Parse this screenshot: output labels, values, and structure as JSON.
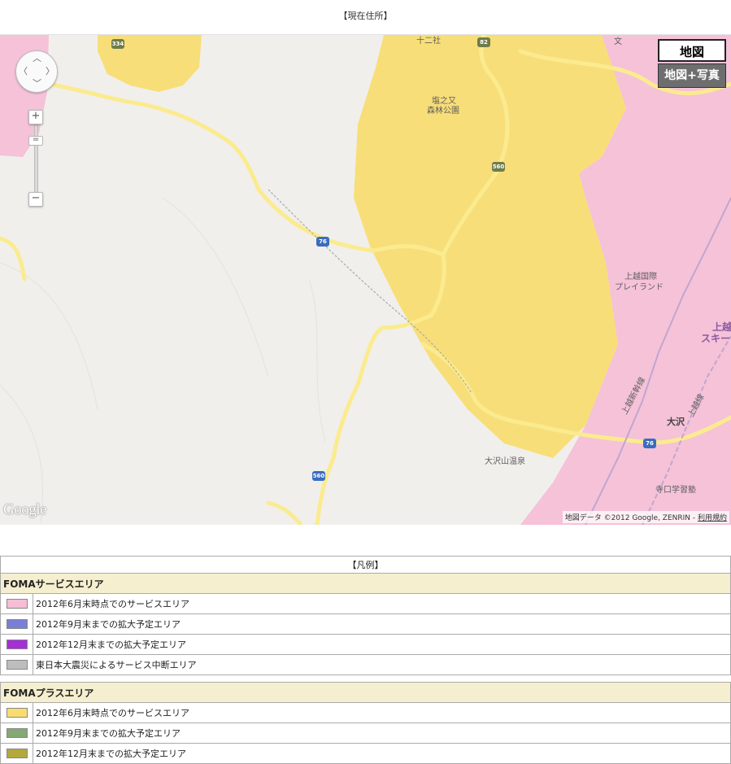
{
  "page": {
    "title": "【現在住所】"
  },
  "map": {
    "maptype": {
      "map_label": "地図",
      "photo_label": "地図+写真"
    },
    "zoom": {
      "plus": "+",
      "minus": "−"
    },
    "logo": "Google",
    "attribution": {
      "text": "地図データ ©2012 Google, ZENRIN - ",
      "terms": "利用規約"
    },
    "labels": {
      "shrine": "十二社",
      "park_line1": "塩之又",
      "park_line2": "森林公園",
      "resort_line1": "上越国際",
      "resort_line2": "プレイランド",
      "ski_line1": "上越",
      "ski_line2": "スキー",
      "shinkansen": "上越新幹線",
      "joetsu_line": "上越線",
      "osawa": "大沢",
      "onsen": "大沢山温泉",
      "juku": "寺口学習塾",
      "school": "文"
    },
    "shields": {
      "r334": "334",
      "r82": "82",
      "r560a": "560",
      "r76a": "76",
      "r560b": "560",
      "r76b": "76"
    },
    "colors": {
      "pink_area": "#f5bdd6",
      "yellow_area": "#f8dc72",
      "road": "#fbeb8f",
      "base": "#f1efeb"
    }
  },
  "legend": {
    "title": "【凡例】",
    "sections": [
      {
        "name": "FOMAサービスエリア",
        "items": [
          {
            "label": "2012年6月末時点でのサービスエリア",
            "color": "#f5bdd6"
          },
          {
            "label": "2012年9月末までの拡大予定エリア",
            "color": "#7a7fd6"
          },
          {
            "label": "2012年12月末までの拡大予定エリア",
            "color": "#a42fd6"
          },
          {
            "label": "東日本大震災によるサービス中断エリア",
            "color": "#bdbdbd"
          }
        ]
      },
      {
        "name": "FOMAプラスエリア",
        "items": [
          {
            "label": "2012年6月末時点でのサービスエリア",
            "color": "#f8dc72"
          },
          {
            "label": "2012年9月末までの拡大予定エリア",
            "color": "#86a874"
          },
          {
            "label": "2012年12月末までの拡大予定エリア",
            "color": "#b3a83c"
          }
        ]
      }
    ]
  }
}
